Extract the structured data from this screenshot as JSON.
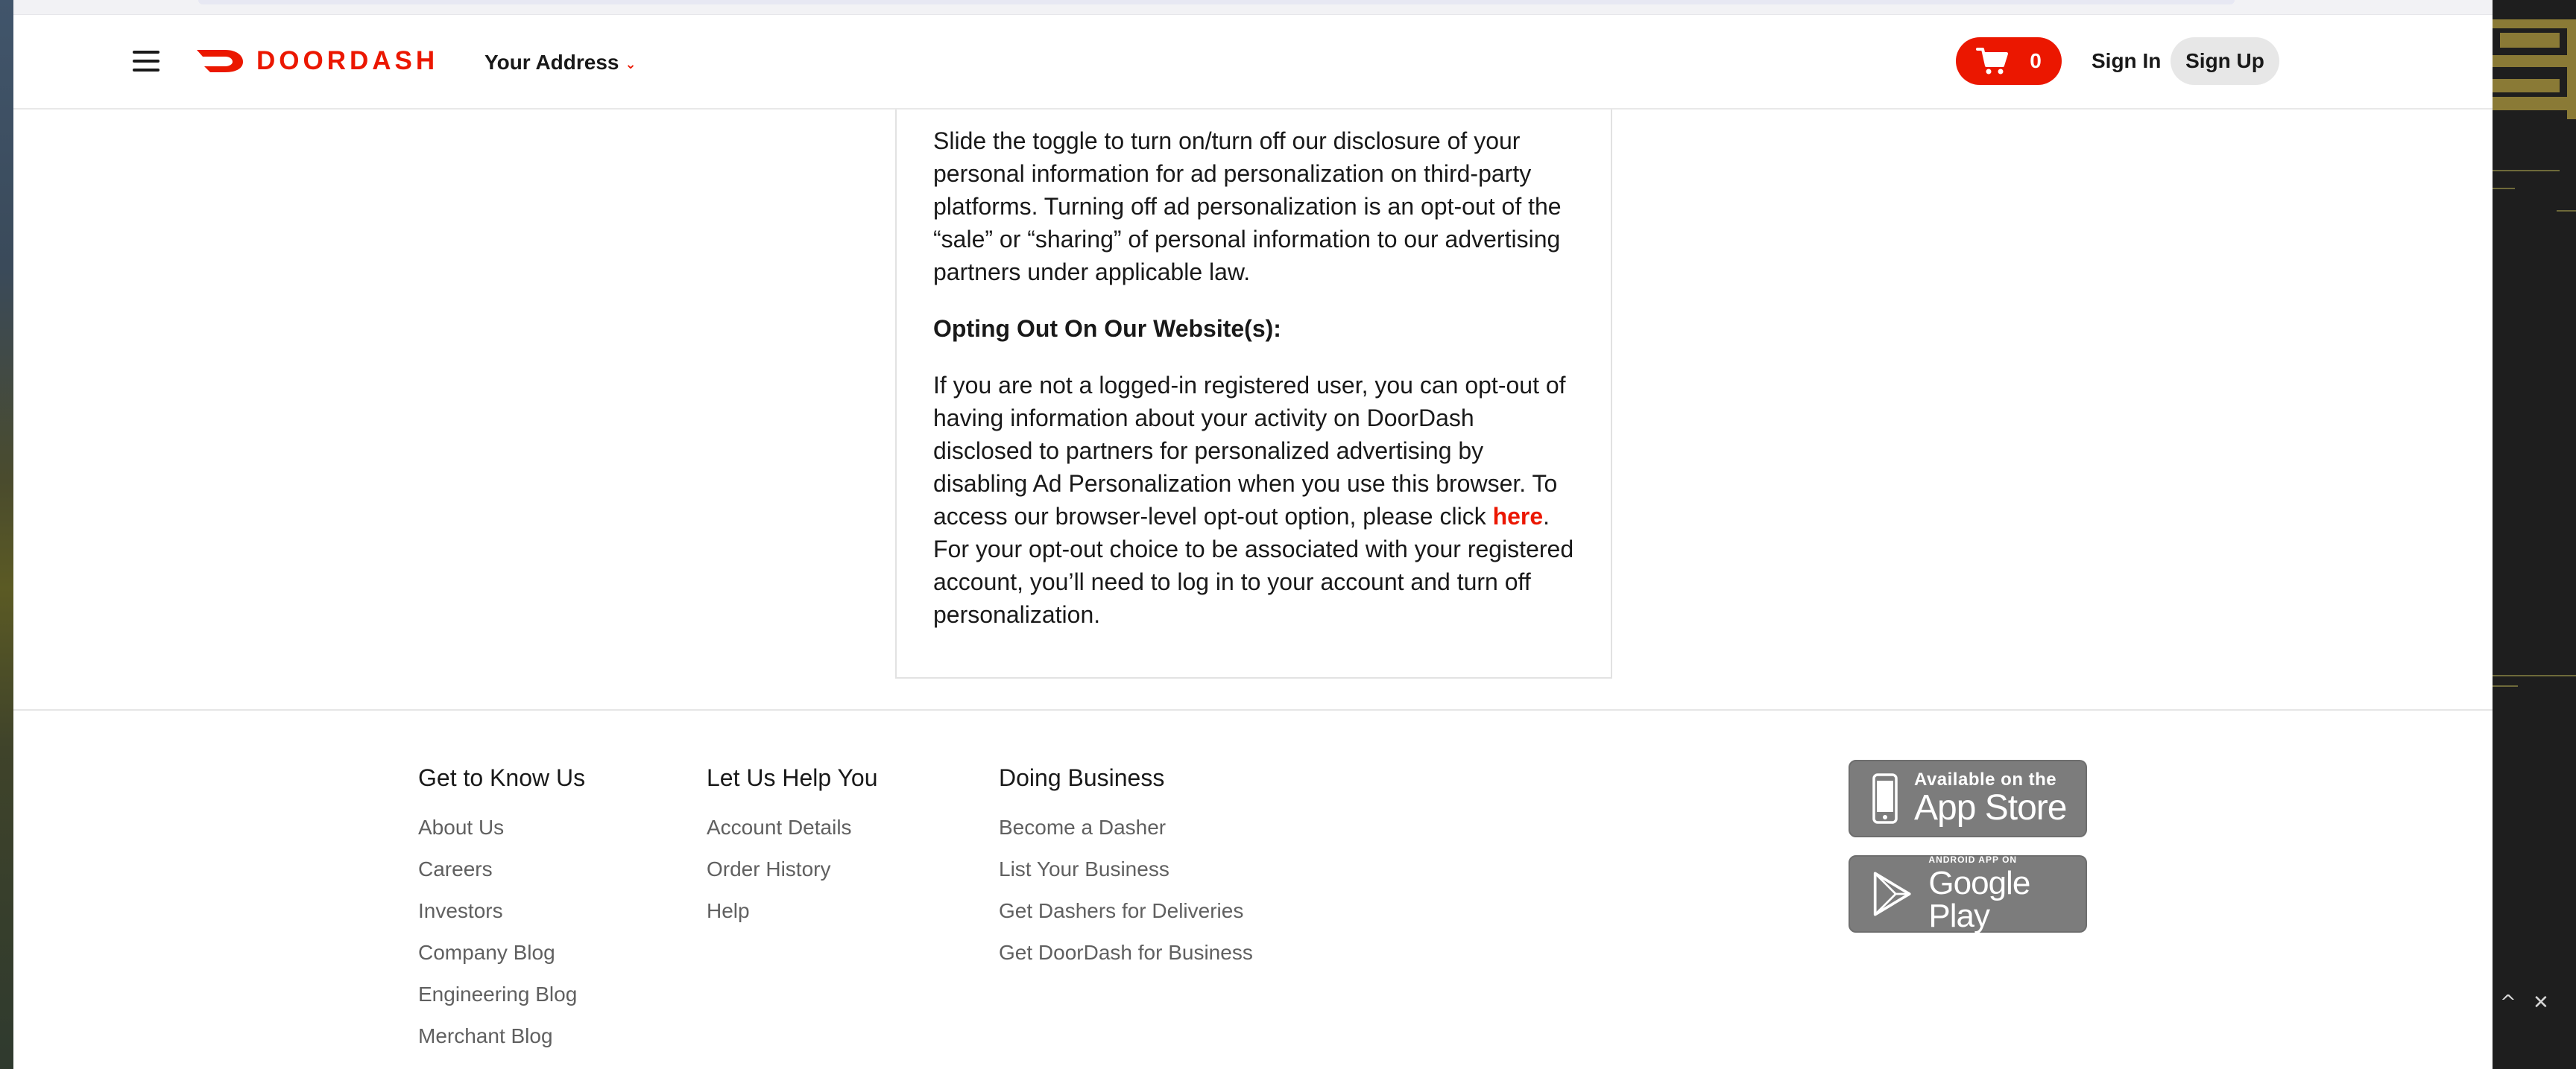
{
  "brand": {
    "name": "DOORDASH",
    "accent": "#eb1700"
  },
  "header": {
    "menu_icon": "hamburger-menu-icon",
    "address_label": "Your Address",
    "address_chevron": "⌄",
    "cart_icon": "shopping-cart-icon",
    "cart_count": "0",
    "sign_in": "Sign In",
    "sign_up": "Sign Up"
  },
  "content": {
    "para1": "Slide the toggle to turn on/turn off our disclosure of your personal information for ad personalization on third-party platforms. Turning off ad personalization is an opt-out of the “sale” or “sharing” of personal information to our advertising partners under applicable law.",
    "heading": "Opting Out On Our Website(s):",
    "para2_before": "If you are not a logged-in registered user, you can opt-out of having information about your activity on DoorDash disclosed to partners for personalized advertising by disabling Ad Personalization when you use this browser. To access our browser-level opt-out option, please click ",
    "para2_link": "here",
    "para2_after": ". For your opt-out choice to be associated with your registered account, you’ll need to log in to your account and turn off personalization."
  },
  "footer": {
    "columns": [
      {
        "title": "Get to Know Us",
        "links": [
          "About Us",
          "Careers",
          "Investors",
          "Company Blog",
          "Engineering Blog",
          "Merchant Blog"
        ]
      },
      {
        "title": "Let Us Help You",
        "links": [
          "Account Details",
          "Order History",
          "Help"
        ]
      },
      {
        "title": "Doing Business",
        "links": [
          "Become a Dasher",
          "List Your Business",
          "Get Dashers for Deliveries",
          "Get DoorDash for Business"
        ]
      }
    ],
    "app_store": {
      "small": "Available on the",
      "big": "App Store",
      "icon": "phone-icon"
    },
    "google_play": {
      "small": "ANDROID APP ON",
      "big": "Google Play",
      "icon": "play-triangle-icon"
    }
  },
  "side_panel": {
    "collapse_glyph": "^",
    "close_glyph": "✕"
  }
}
